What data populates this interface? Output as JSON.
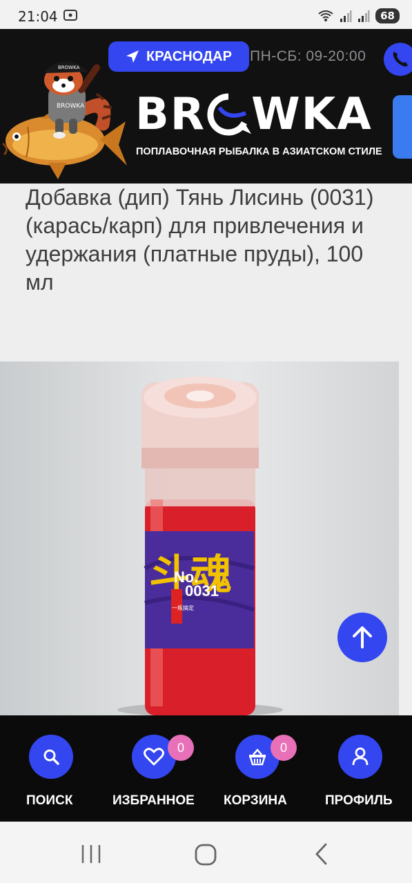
{
  "status_bar": {
    "time": "21:04",
    "battery": "68",
    "icons": [
      "screenshot-icon",
      "wifi-icon",
      "signal-icon",
      "signal-icon",
      "battery-icon"
    ]
  },
  "header": {
    "city": "КРАСНОДАР",
    "hours": "ПН-СБ: 09-20:00",
    "logo_left": "BR",
    "logo_right": "WKA",
    "tagline": "ПОПЛАВОЧНАЯ РЫБАЛКА В АЗИАТСКОМ СТИЛЕ",
    "mascot_cap_text": "BROWKA",
    "accent_color": "#3446f0"
  },
  "product": {
    "title": "Добавка (дип) Тянь Лисинь (0031) (карась/карп) для привлечения и удержания (платные пруды), 100 мл",
    "label_no": "No.",
    "label_code": "0031",
    "label_small": "一瓶搞定",
    "label_hieroglyphs": "斗魂"
  },
  "bottom_nav": {
    "items": [
      {
        "label": "ПОИСК",
        "icon": "search-icon"
      },
      {
        "label": "ИЗБРАННОЕ",
        "icon": "heart-icon",
        "badge": "0"
      },
      {
        "label": "КОРЗИНА",
        "icon": "basket-icon",
        "badge": "0"
      },
      {
        "label": "ПРОФИЛЬ",
        "icon": "user-icon"
      }
    ],
    "badge_color": "#e870b8"
  },
  "android_nav": [
    "recents-icon",
    "home-icon",
    "back-icon"
  ]
}
